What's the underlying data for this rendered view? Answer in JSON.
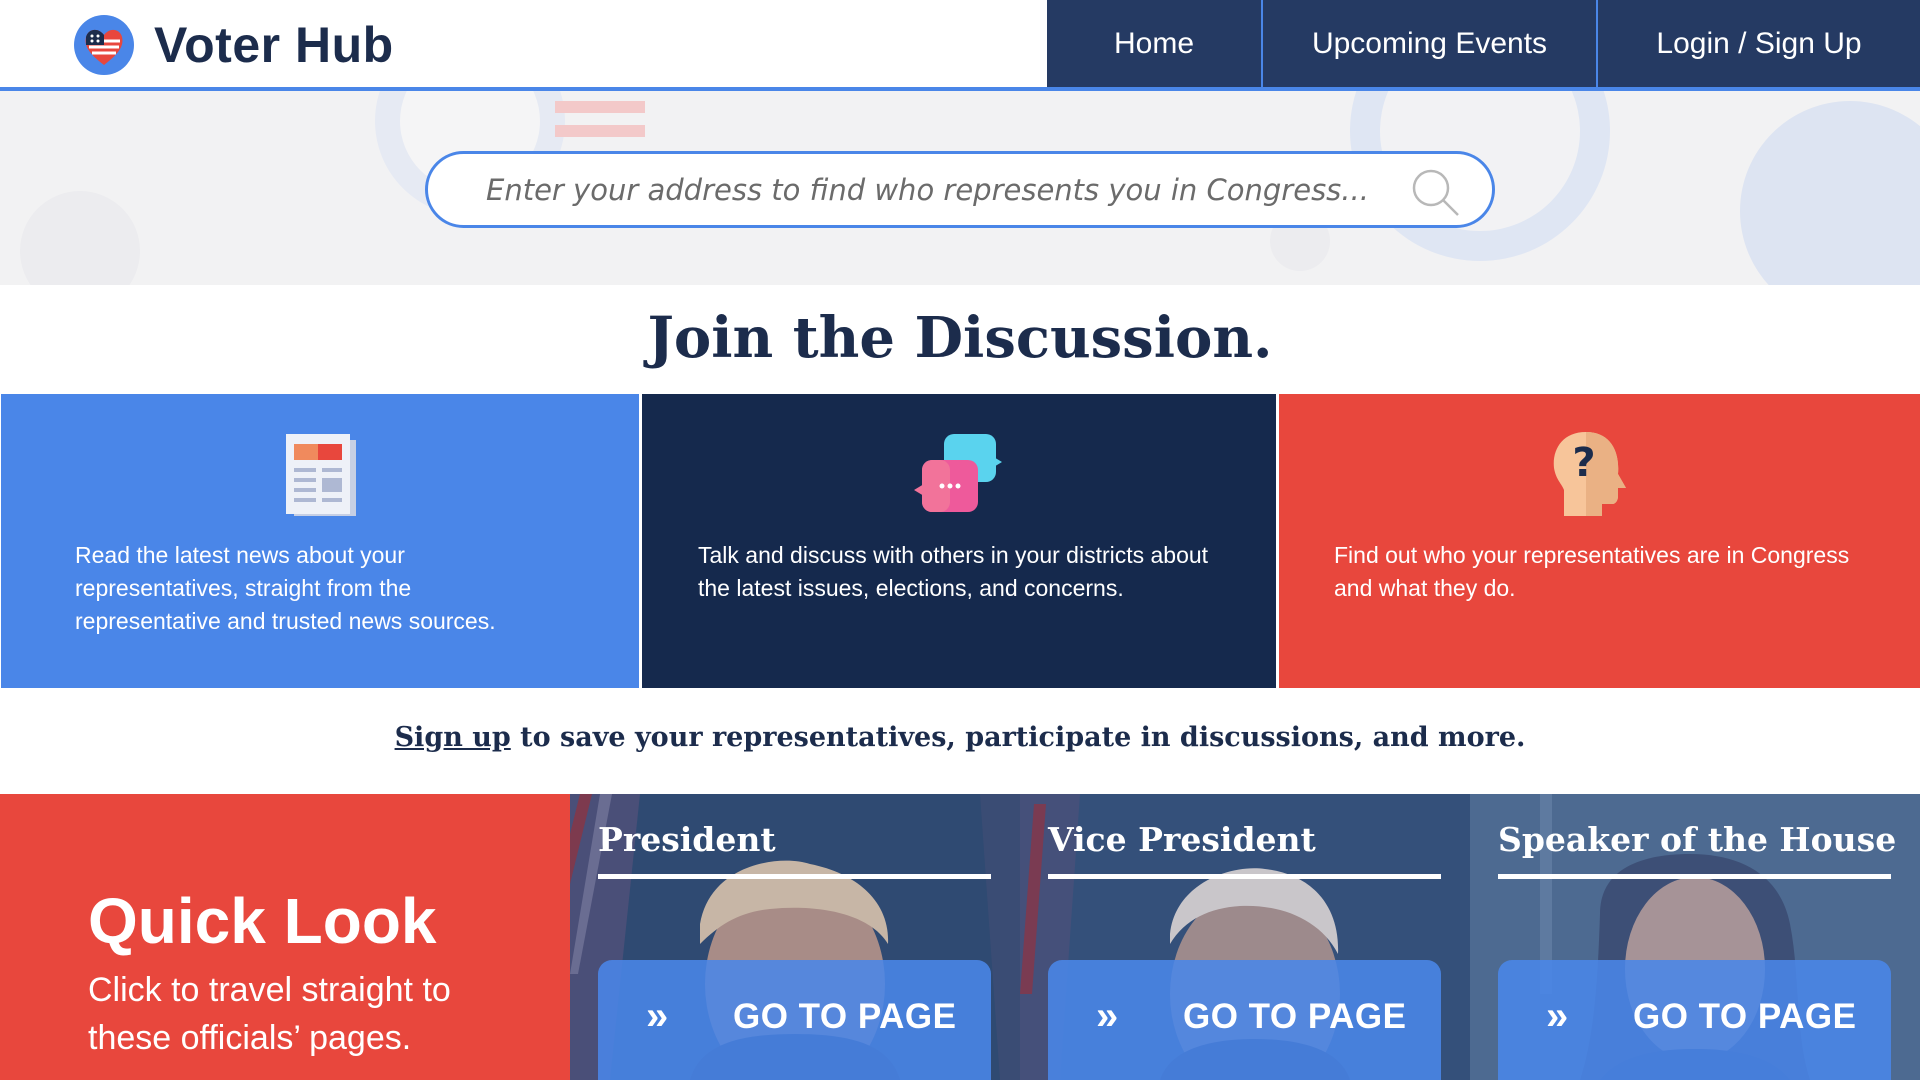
{
  "header": {
    "brand": "Voter Hub",
    "nav": {
      "home": "Home",
      "events": "Upcoming Events",
      "login": "Login / Sign Up"
    }
  },
  "search": {
    "placeholder": "Enter your address to find who represents you in Congress..."
  },
  "join": {
    "title": "Join the Discussion."
  },
  "cards": {
    "news": "Read the latest news about your representatives, straight from the representative and trusted news sources.",
    "discuss": "Talk and discuss with others in your districts about the latest issues, elections, and concerns.",
    "reps": "Find out who your representatives are in Congress and what they do."
  },
  "signup": {
    "link": "Sign up",
    "rest": " to save your representatives, participate in discussions, and more."
  },
  "quick_look": {
    "title": "Quick Look",
    "subtitle": "Click to travel straight to these officials’ pages."
  },
  "officials": {
    "president": {
      "title": "President",
      "button": "GO TO PAGE"
    },
    "vp": {
      "title": "Vice President",
      "button": "GO TO PAGE"
    },
    "speaker": {
      "title": "Speaker of the House",
      "button": "GO TO PAGE"
    },
    "button_chevron": "»"
  },
  "colors": {
    "brand_blue": "#4a86e8",
    "navy": "#15294d",
    "nav_bg": "#253a63",
    "red": "#e8473d"
  }
}
